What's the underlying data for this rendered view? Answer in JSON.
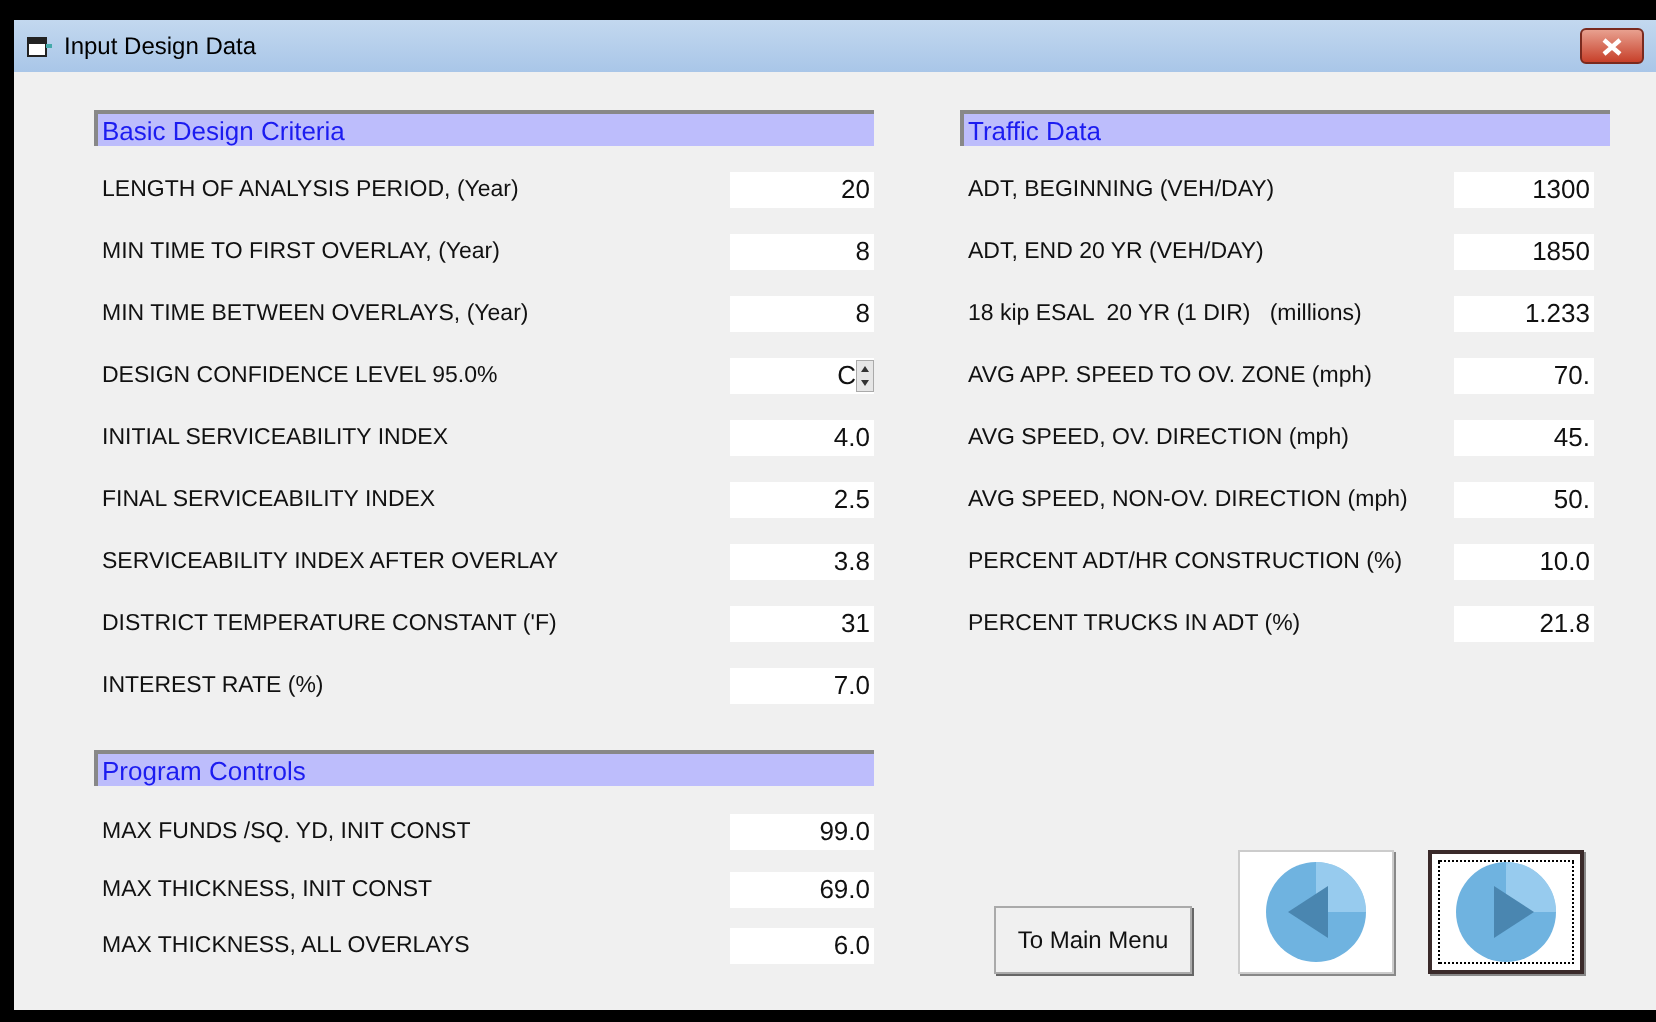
{
  "window": {
    "title": "Input Design Data"
  },
  "basic_design_criteria": {
    "title": "Basic Design Criteria",
    "fields": [
      {
        "label": "LENGTH OF ANALYSIS PERIOD, (Year)",
        "value": "20",
        "kind": "text"
      },
      {
        "label": "MIN TIME TO FIRST OVERLAY, (Year)",
        "value": "8",
        "kind": "text"
      },
      {
        "label": "MIN TIME BETWEEN OVERLAYS, (Year)",
        "value": "8",
        "kind": "text"
      },
      {
        "label": "DESIGN CONFIDENCE LEVEL 95.0%",
        "value": "C",
        "kind": "spinner"
      },
      {
        "label": "INITIAL SERVICEABILITY INDEX",
        "value": "4.0",
        "kind": "text"
      },
      {
        "label": "FINAL SERVICEABILITY INDEX",
        "value": "2.5",
        "kind": "text"
      },
      {
        "label": "SERVICEABILITY INDEX AFTER OVERLAY",
        "value": "3.8",
        "kind": "text"
      },
      {
        "label": "DISTRICT TEMPERATURE CONSTANT ('F)",
        "value": "31",
        "kind": "text"
      },
      {
        "label": "INTEREST RATE (%)",
        "value": "7.0",
        "kind": "text"
      }
    ]
  },
  "program_controls": {
    "title": "Program Controls",
    "fields": [
      {
        "label": "MAX FUNDS /SQ. YD, INIT CONST",
        "value": "99.0",
        "kind": "text"
      },
      {
        "label": "MAX THICKNESS, INIT CONST",
        "value": "69.0",
        "kind": "text"
      },
      {
        "label": "MAX THICKNESS, ALL OVERLAYS",
        "value": "6.0",
        "kind": "text"
      }
    ]
  },
  "traffic_data": {
    "title": "Traffic Data",
    "fields": [
      {
        "label": "ADT, BEGINNING (VEH/DAY)",
        "value": "1300",
        "kind": "text"
      },
      {
        "label": "ADT, END 20 YR (VEH/DAY)",
        "value": "1850",
        "kind": "text"
      },
      {
        "label": "18 kip ESAL  20 YR (1 DIR)   (millions)",
        "value": "1.233",
        "kind": "text"
      },
      {
        "label": "AVG APP. SPEED TO OV. ZONE (mph)",
        "value": "70.",
        "kind": "text"
      },
      {
        "label": "AVG SPEED, OV. DIRECTION (mph)",
        "value": "45.",
        "kind": "text"
      },
      {
        "label": "AVG SPEED, NON-OV. DIRECTION (mph)",
        "value": "50.",
        "kind": "text"
      },
      {
        "label": "PERCENT ADT/HR CONSTRUCTION (%)",
        "value": "10.0",
        "kind": "text"
      },
      {
        "label": "PERCENT TRUCKS IN ADT (%)",
        "value": "21.8",
        "kind": "text"
      }
    ]
  },
  "buttons": {
    "main_menu": "To Main Menu",
    "back_focused": false,
    "next_focused": true
  }
}
